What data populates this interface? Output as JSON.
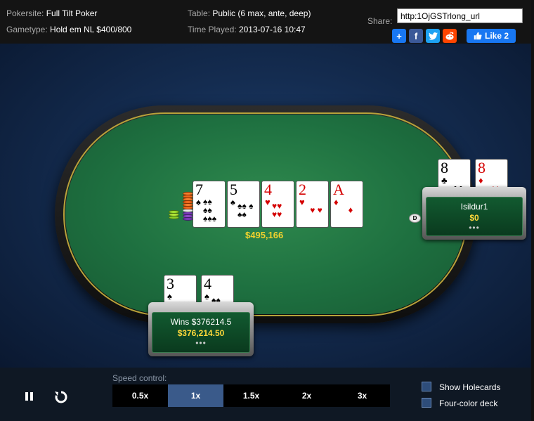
{
  "header": {
    "pokersite_label": "Pokersite:",
    "pokersite_value": "Full Tilt Poker",
    "gametype_label": "Gametype:",
    "gametype_value": "Hold em NL $400/800",
    "table_label": "Table:",
    "table_value": "Public (6 max, ante, deep)",
    "time_label": "Time Played:",
    "time_value": "2013-07-16 10:47",
    "share_label": "Share:",
    "share_url": "http:1OjGSTrlong_url",
    "share_buttons": [
      {
        "icon": "plus-icon",
        "color": "#1877f2"
      },
      {
        "icon": "facebook-icon",
        "color": "#3b5998"
      },
      {
        "icon": "twitter-icon",
        "color": "#1da1f2"
      },
      {
        "icon": "reddit-icon",
        "color": "#ff4500"
      }
    ],
    "like_label": "Like 2"
  },
  "board": {
    "cards": [
      {
        "rank": "7",
        "suit": "♠"
      },
      {
        "rank": "5",
        "suit": "♠"
      },
      {
        "rank": "4",
        "suit": "♥"
      },
      {
        "rank": "2",
        "suit": "♥"
      },
      {
        "rank": "A",
        "suit": "♦"
      }
    ],
    "pot": "$495,166"
  },
  "seats": {
    "right": {
      "name": "Isildur1",
      "stack": "$0",
      "cards": [
        {
          "rank": "8",
          "suit": "♣"
        },
        {
          "rank": "8",
          "suit": "♦"
        }
      ]
    },
    "bottom": {
      "name": "Wins $376214.5",
      "stack": "$376,214.50",
      "cards": [
        {
          "rank": "3",
          "suit": "♠"
        },
        {
          "rank": "4",
          "suit": "♠"
        }
      ]
    }
  },
  "dealer_button": "D",
  "controls": {
    "speed_label": "Speed control:",
    "speeds": [
      "0.5x",
      "1x",
      "1.5x",
      "2x",
      "3x"
    ],
    "active_speed": "1x",
    "show_holecards": "Show Holecards",
    "four_color_deck": "Four-color deck"
  }
}
